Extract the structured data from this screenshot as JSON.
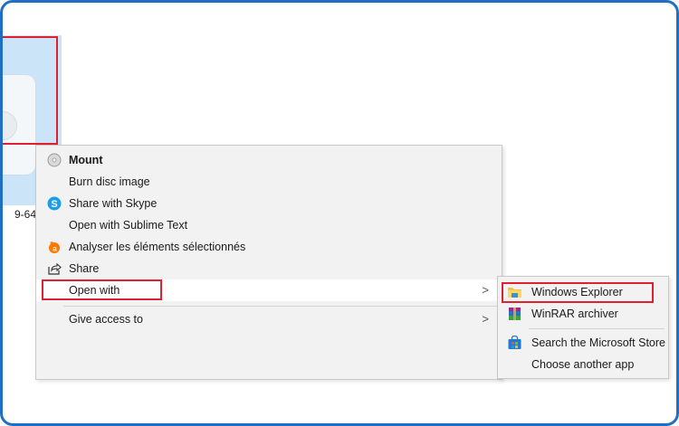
{
  "file": {
    "label": "9-64"
  },
  "context_menu": {
    "items": [
      {
        "label": "Mount",
        "icon": "disc-icon"
      },
      {
        "label": "Burn disc image",
        "icon": ""
      },
      {
        "label": "Share with Skype",
        "icon": "skype-icon"
      },
      {
        "label": "Open with Sublime Text",
        "icon": ""
      },
      {
        "label": "Analyser les éléments sélectionnés",
        "icon": "avast-icon"
      },
      {
        "label": "Share",
        "icon": "share-icon"
      },
      {
        "label": "Open with",
        "icon": "",
        "arrow": ">"
      },
      {
        "label": "Give access to",
        "icon": "",
        "arrow": ">"
      }
    ]
  },
  "open_with_submenu": {
    "items": [
      {
        "label": "Windows Explorer",
        "icon": "folder-icon"
      },
      {
        "label": "WinRAR archiver",
        "icon": "winrar-icon"
      },
      {
        "label": "Search the Microsoft Store",
        "icon": "store-icon"
      },
      {
        "label": "Choose another app",
        "icon": ""
      }
    ]
  },
  "colors": {
    "highlight": "#e02030",
    "frame": "#1f6fc5",
    "selection": "#cce4f7",
    "menu_bg": "#f2f2f2"
  }
}
